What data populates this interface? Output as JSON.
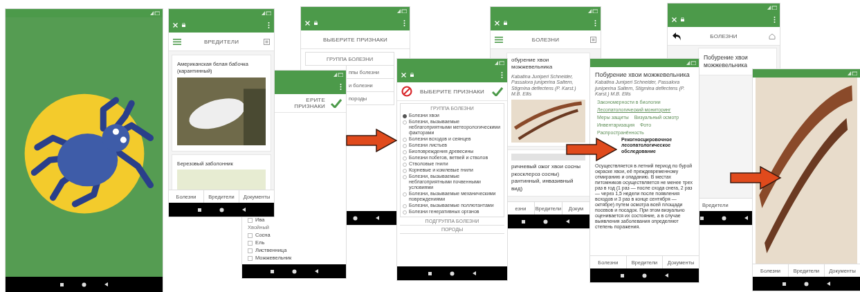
{
  "screens": [
    {
      "kind": "splash"
    },
    {
      "kind": "cards",
      "browser": true,
      "header": {
        "left_icon": {
          "kind": "menu"
        },
        "title": "ВРЕДИТЕЛИ",
        "right_icon": {
          "kind": "grid"
        }
      },
      "cards": [
        {
          "kind": "photo",
          "title": "Американская белая бабочка (карантинный)"
        },
        {
          "kind": "photo",
          "title": "Березовый заболонник"
        }
      ],
      "tabs": [
        "Болезни",
        "Вредители",
        "Документы"
      ]
    },
    {
      "kind": "checklist",
      "browser": true,
      "header": {
        "title": "ЕРИТЕ ПРИЗНАКИ",
        "right_icon": {
          "kind": "check"
        }
      },
      "items": [
        {
          "label": "Ива",
          "kind": "option",
          "checked": false
        },
        {
          "label": "Хвойный",
          "kind": "heading"
        },
        {
          "label": "Сосна",
          "kind": "option",
          "checked": false
        },
        {
          "label": "Ель",
          "kind": "option",
          "checked": false
        },
        {
          "label": "Лиственница",
          "kind": "option",
          "checked": false
        },
        {
          "label": "Можжевельник",
          "kind": "option",
          "checked": false
        }
      ]
    },
    {
      "kind": "rows",
      "browser": true,
      "header": {
        "title": "ВЫБЕРИТЕ ПРИЗНАКИ"
      },
      "rows": [
        "ГРУППА БОЛЕЗНИ",
        "ппы болезни",
        "и болезни",
        "породы"
      ]
    },
    {
      "kind": "radio",
      "browser": true,
      "header": {
        "left_icon": {
          "kind": "ban"
        },
        "title": "ВЫБЕРИТЕ ПРИЗНАКИ",
        "right_icon": {
          "kind": "check"
        }
      },
      "group": "ГРУППА БОЛЕЗНИ",
      "options": [
        {
          "label": "Болезни хвои",
          "selected": true
        },
        {
          "label": "Болезни, вызываемые неблагоприятными метеорологическими факторами",
          "selected": false
        },
        {
          "label": "Болезни всходов и сеянцев",
          "selected": false
        },
        {
          "label": "Болезни листьев",
          "selected": false
        },
        {
          "label": "Биоповреждения древесины",
          "selected": false
        },
        {
          "label": "Болезни побегов, ветвей и стволов",
          "selected": false
        },
        {
          "label": "Стволовые гнили",
          "selected": false
        },
        {
          "label": "Корневые и комлевые гнили",
          "selected": false
        },
        {
          "label": "Болезни, вызываемые неблагоприятными почвенными условиями",
          "selected": false
        },
        {
          "label": "Болезни, вызываемые механическими повреждениями",
          "selected": false
        },
        {
          "label": "Болезни, вызываемые поллютантами",
          "selected": false
        },
        {
          "label": "Болезни генеративных органов",
          "selected": false
        }
      ],
      "sections": [
        "ПОДГРУППА БОЛЕЗНИ",
        "ПОРОДЫ"
      ]
    },
    {
      "kind": "cards",
      "browser": true,
      "header": {
        "left_icon": {
          "kind": "menu"
        },
        "title": "БОЛЕЗНИ",
        "right_icon": {
          "kind": "grid"
        }
      },
      "cards": [
        {
          "kind": "photo",
          "title": "обурение хвои можжевельника",
          "subtitle": "Kabatina Juniperi Schneider, Passalora juniperina Saltern, Stigmina deflectens (P. Karst.) M.B. Ellis"
        },
        {
          "kind": "striped",
          "title": "ричневый ожог хвои сосны ркосклероз сосны) рантинный, инвазивный вид)"
        }
      ],
      "tabs": [
        "езни",
        "Вредители",
        "Докум"
      ]
    },
    {
      "kind": "article",
      "title": "Побурение хвои можжевельника",
      "subtitle": "Kabatina Juniperi Schneider, Passalora juniperina Saltern, Stigmina deflectens (P. Karst.) M.B. Ellis",
      "links": [
        [
          "Закономерности в биологии"
        ],
        [
          "Лесопатологический мониторинг"
        ],
        [
          "Меры защиты",
          "Визуальный осмотр"
        ],
        [
          "Инвентаризация",
          "Фото"
        ],
        [
          "Распространённость"
        ]
      ],
      "heading": "Рекогносцировочное лесопатологическое обследование",
      "paragraph": "Осуществляется в летний период по бурой окраске хвои, её преждевременному отмиранию и опаданию. В местах питомников осуществляется не менее трех раз в год (1 раз — после схода снега, 2 раз — через 1,5 недели после появления всходов и 3 раз в конце сентября — октябре) путем осмотра всей площади посевов и посадок. При этом визуально оценивается их состояние, а в случае выявления заболевания определяют степень поражения.",
      "tabs": [
        "Болезни",
        "Вредители",
        "Документы"
      ]
    },
    {
      "kind": "cards",
      "browser": true,
      "header": {
        "left_icon": {
          "kind": "back"
        },
        "title": "БОЛЕЗНИ",
        "right_icon": {
          "kind": "home"
        }
      },
      "cards": [
        {
          "kind": "plain",
          "title": "Побурение хвои можжевельника"
        }
      ],
      "tabs": [
        "Вредители"
      ]
    },
    {
      "kind": "photo",
      "tabs": [
        "Болезни",
        "Вредители",
        "Документы"
      ]
    }
  ]
}
